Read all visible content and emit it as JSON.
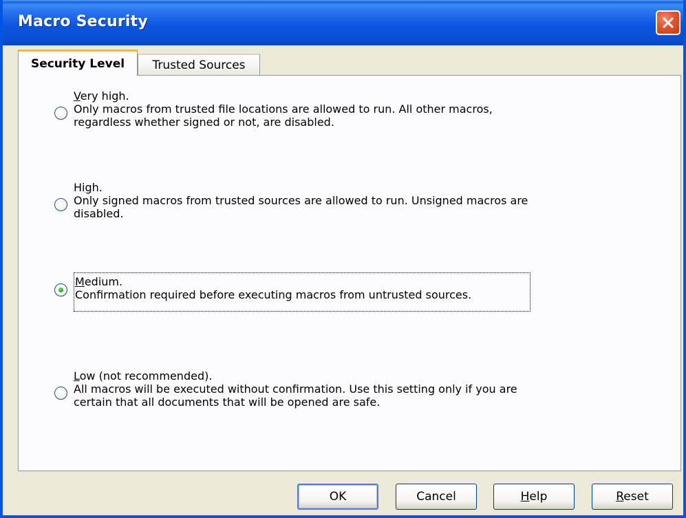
{
  "window": {
    "title": "Macro Security"
  },
  "tabs": [
    {
      "label": "Security Level",
      "active": true
    },
    {
      "label": "Trusted Sources",
      "active": false
    }
  ],
  "options": [
    {
      "title_mnemonic": "V",
      "title_rest": "ery high.",
      "lines": [
        "Only macros from trusted file locations are allowed to run. All other macros,",
        "regardless whether signed or not, are disabled."
      ],
      "selected": false
    },
    {
      "title_prefix": "Hi",
      "title_mnemonic": "g",
      "title_rest": "h.",
      "lines": [
        "Only signed macros from trusted sources are allowed to run. Unsigned macros are",
        "disabled."
      ],
      "selected": false
    },
    {
      "title_mnemonic": "M",
      "title_rest": "edium.",
      "lines": [
        "Confirmation required before executing macros from untrusted sources."
      ],
      "selected": true
    },
    {
      "title_mnemonic": "L",
      "title_rest": "ow (not recommended).",
      "lines": [
        "All macros will be executed without confirmation. Use this setting only if you are",
        "certain that all documents that will be opened are safe."
      ],
      "selected": false
    }
  ],
  "buttons": {
    "ok": "OK",
    "cancel": "Cancel",
    "help_mnemonic": "H",
    "help_rest": "elp",
    "reset_mnemonic": "R",
    "reset_rest": "eset"
  },
  "colors": {
    "titlebar": "#0a4fd6",
    "dialog_bg": "#ece9d8",
    "active_tab_accent": "#f5b83a",
    "radio_selected": "#25a925",
    "close_button": "#e0542f"
  },
  "icons": {
    "close": "close-x-icon"
  }
}
